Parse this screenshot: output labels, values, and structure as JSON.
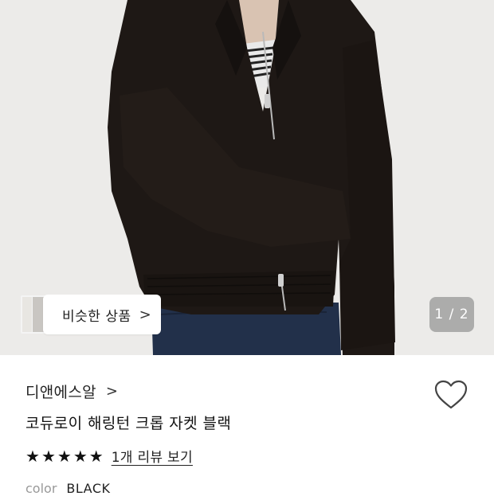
{
  "gallery": {
    "similar_label": "비슷한 상품",
    "chevron": ">",
    "counter": "1 / 2"
  },
  "product": {
    "brand": "디앤에스알",
    "brand_chevron": ">",
    "title": "코듀로이 해링턴 크롭 자켓 블랙",
    "stars": [
      "★",
      "★",
      "★",
      "★",
      "★"
    ],
    "review_link": "1개 리뷰 보기",
    "color_label": "color",
    "color_value": "BLACK"
  },
  "colors": {
    "photo_background": "#ecebe9",
    "jacket": "#1e1815",
    "jeans": "#22304a",
    "counter_bg": "#8a8a8a"
  },
  "icons": {
    "heart": "heart-outline-icon",
    "star": "star-filled-icon",
    "chevron": "chevron-right-icon"
  }
}
